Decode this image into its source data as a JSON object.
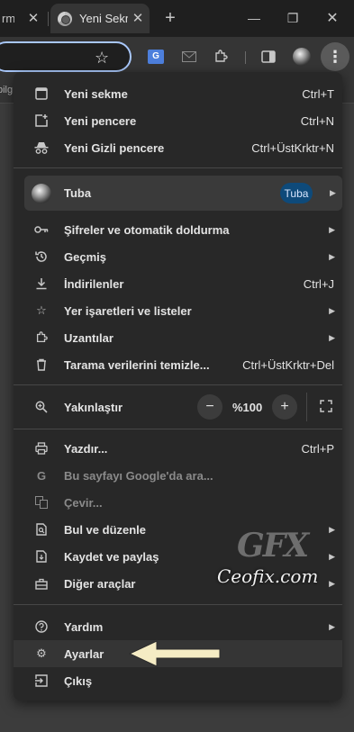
{
  "tabs": [
    {
      "title": "rma",
      "close": "✕"
    },
    {
      "title": "Yeni Sekme",
      "close": "✕"
    }
  ],
  "window": {
    "new_tab": "+",
    "minimize": "—",
    "maximize": "❐",
    "close": "✕"
  },
  "bookmarks_text": "bilg",
  "profile": {
    "name": "Tuba",
    "badge": "Tuba"
  },
  "menu": {
    "items_top": [
      {
        "label": "Yeni sekme",
        "shortcut": "Ctrl+T"
      },
      {
        "label": "Yeni pencere",
        "shortcut": "Ctrl+N"
      },
      {
        "label": "Yeni Gizli pencere",
        "shortcut": "Ctrl+ÜstKrktr+N"
      }
    ],
    "items_mid": [
      {
        "label": "Şifreler ve otomatik doldurma",
        "shortcut": ""
      },
      {
        "label": "Geçmiş",
        "shortcut": ""
      },
      {
        "label": "İndirilenler",
        "shortcut": "Ctrl+J"
      },
      {
        "label": "Yer işaretleri ve listeler",
        "shortcut": ""
      },
      {
        "label": "Uzantılar",
        "shortcut": ""
      },
      {
        "label": "Tarama verilerini temizle...",
        "shortcut": "Ctrl+ÜstKrktr+Del"
      }
    ],
    "zoom": {
      "label": "Yakınlaştır",
      "minus": "−",
      "value": "%100",
      "plus": "+"
    },
    "items_tools": [
      {
        "label": "Yazdır...",
        "shortcut": "Ctrl+P"
      },
      {
        "label": "Bu sayfayı Google'da ara...",
        "shortcut": ""
      },
      {
        "label": "Çevir...",
        "shortcut": ""
      },
      {
        "label": "Bul ve düzenle",
        "shortcut": ""
      },
      {
        "label": "Kaydet ve paylaş",
        "shortcut": ""
      },
      {
        "label": "Diğer araçlar",
        "shortcut": ""
      }
    ],
    "items_bottom": [
      {
        "label": "Yardım",
        "shortcut": ""
      },
      {
        "label": "Ayarlar",
        "shortcut": ""
      },
      {
        "label": "Çıkış",
        "shortcut": ""
      }
    ]
  },
  "watermark": {
    "logo": "GFX",
    "text": "Ceofix.com"
  },
  "colors": {
    "accent": "#a8c7fa",
    "badge": "#0e4a7a",
    "menu_bg": "#282828",
    "arrow": "#f5ecc4"
  },
  "icons": [
    "star-icon",
    "translate-icon",
    "mail-icon",
    "extensions-icon",
    "side-panel-icon",
    "kebab-menu-icon"
  ]
}
